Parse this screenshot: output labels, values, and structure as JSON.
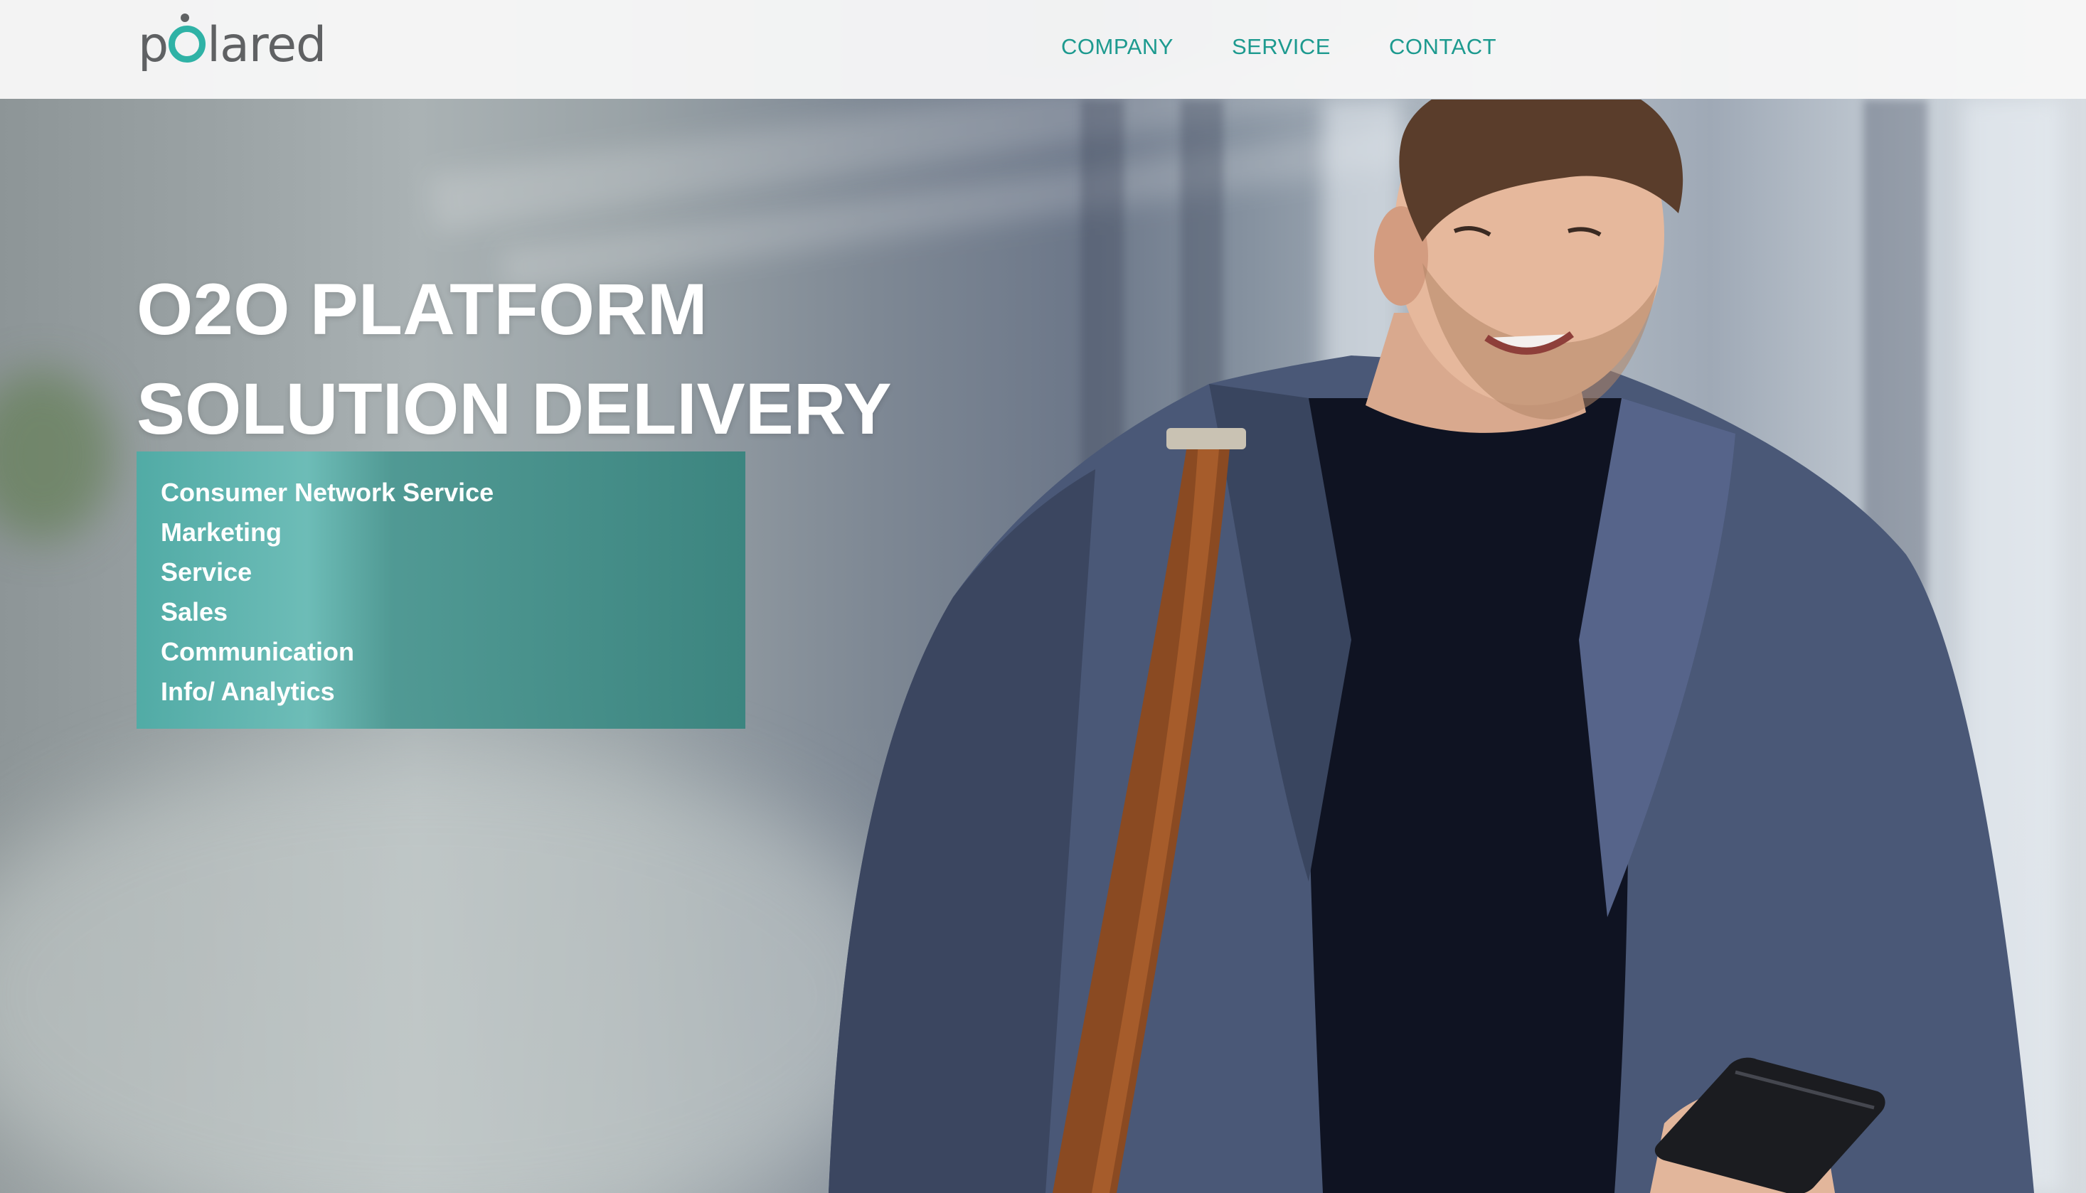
{
  "brand": {
    "logo_prefix": "p",
    "logo_suffix": "lared",
    "accent_color": "#1d9a8f",
    "logo_ring_color": "#2fb2a6"
  },
  "nav": {
    "items": [
      {
        "label": "COMPANY"
      },
      {
        "label": "SERVICE"
      },
      {
        "label": "CONTACT"
      }
    ]
  },
  "hero": {
    "headline_line1": "O2O PLATFORM",
    "headline_line2": "SOLUTION DELIVERY",
    "services": [
      "Consumer Network Service",
      "Marketing",
      "Service",
      "Sales",
      "Communication",
      "Info/ Analytics"
    ],
    "image_subject": "man in blazer smiling at smartphone"
  }
}
